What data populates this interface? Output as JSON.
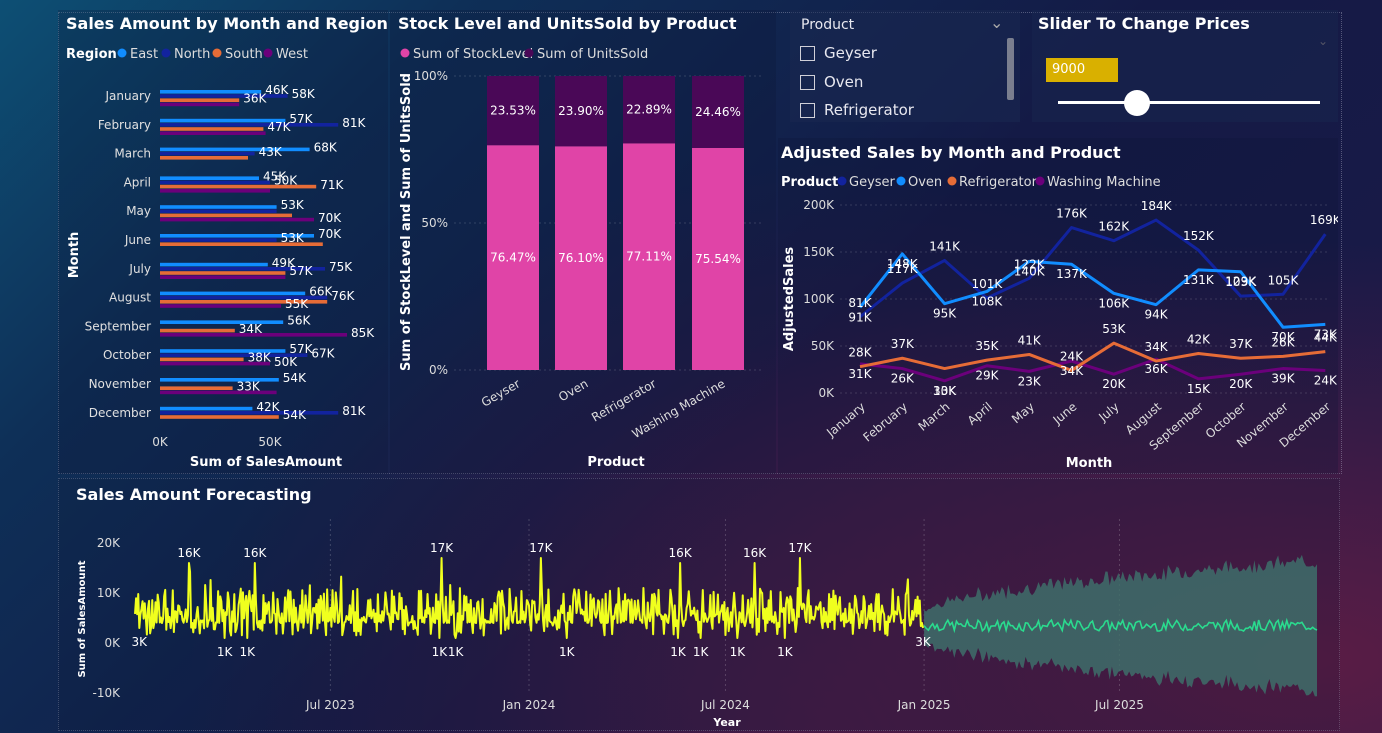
{
  "colors": {
    "east": "#118DFF",
    "north": "#12239E",
    "south": "#E66C37",
    "west": "#6B007B",
    "stock": "#E044A7",
    "units": "#4A0857",
    "geyser": "#12239E",
    "oven": "#118DFF",
    "refrigerator": "#E66C37",
    "washing": "#6B007B",
    "actual": "#F0FF1E",
    "forecast": "#2ADB8E",
    "band": "#3E6E6A",
    "slider_box": "#D9B000"
  },
  "panels": {
    "region": "Sales Amount by Month and Region",
    "stock": "Stock Level and UnitsSold by Product",
    "adjusted": "Adjusted Sales by Month and Product",
    "forecast": "Sales Amount Forecasting"
  },
  "slicer": {
    "title": "Product",
    "items": [
      "Geyser",
      "Oven",
      "Refrigerator"
    ]
  },
  "slider": {
    "title": "Slider To Change Prices",
    "value": "9000",
    "position": 0.3
  },
  "chart_data": [
    {
      "type": "bar",
      "orientation": "horizontal",
      "title": "Sales Amount by Month and Region",
      "xlabel": "Sum of SalesAmount",
      "ylabel": "Month",
      "legend_title": "Region",
      "xlim": [
        0,
        100
      ],
      "x_ticks": [
        "0K",
        "50K"
      ],
      "categories": [
        "January",
        "February",
        "March",
        "April",
        "May",
        "June",
        "July",
        "August",
        "September",
        "October",
        "November",
        "December"
      ],
      "series": [
        {
          "name": "East",
          "values": [
            46,
            57,
            68,
            45,
            53,
            70,
            49,
            66,
            56,
            57,
            54,
            42
          ]
        },
        {
          "name": "North",
          "values": [
            58,
            81,
            43,
            50,
            53,
            53,
            75,
            76,
            null,
            67,
            null,
            81
          ]
        },
        {
          "name": "South",
          "values": [
            36,
            47,
            40,
            71,
            60,
            74,
            57,
            76,
            34,
            38,
            33,
            54
          ]
        },
        {
          "name": "West",
          "values": [
            36,
            48,
            null,
            50,
            70,
            null,
            57,
            55,
            85,
            50,
            53,
            null
          ]
        }
      ],
      "labels": [
        {
          "cat": 0,
          "s": 0,
          "text": "46K"
        },
        {
          "cat": 0,
          "s": 1,
          "text": "58K"
        },
        {
          "cat": 0,
          "s": 2,
          "text": "36K"
        },
        {
          "cat": 1,
          "s": 0,
          "text": "57K"
        },
        {
          "cat": 1,
          "s": 1,
          "text": "81K"
        },
        {
          "cat": 1,
          "s": 2,
          "text": "47K"
        },
        {
          "cat": 2,
          "s": 0,
          "text": "68K"
        },
        {
          "cat": 2,
          "s": 1,
          "text": "43K"
        },
        {
          "cat": 3,
          "s": 0,
          "text": "45K"
        },
        {
          "cat": 3,
          "s": 1,
          "text": "50K"
        },
        {
          "cat": 3,
          "s": 2,
          "text": "71K"
        },
        {
          "cat": 4,
          "s": 0,
          "text": "53K"
        },
        {
          "cat": 4,
          "s": 3,
          "text": "70K"
        },
        {
          "cat": 5,
          "s": 0,
          "text": "70K"
        },
        {
          "cat": 5,
          "s": 1,
          "text": "53K"
        },
        {
          "cat": 6,
          "s": 0,
          "text": "49K"
        },
        {
          "cat": 6,
          "s": 1,
          "text": "75K"
        },
        {
          "cat": 6,
          "s": 2,
          "text": "57K"
        },
        {
          "cat": 7,
          "s": 0,
          "text": "66K"
        },
        {
          "cat": 7,
          "s": 1,
          "text": "76K"
        },
        {
          "cat": 7,
          "s": 3,
          "text": "55K"
        },
        {
          "cat": 8,
          "s": 0,
          "text": "56K"
        },
        {
          "cat": 8,
          "s": 2,
          "text": "34K"
        },
        {
          "cat": 8,
          "s": 3,
          "text": "85K"
        },
        {
          "cat": 9,
          "s": 0,
          "text": "57K"
        },
        {
          "cat": 9,
          "s": 1,
          "text": "67K"
        },
        {
          "cat": 9,
          "s": 2,
          "text": "38K"
        },
        {
          "cat": 9,
          "s": 3,
          "text": "50K"
        },
        {
          "cat": 10,
          "s": 0,
          "text": "54K"
        },
        {
          "cat": 10,
          "s": 2,
          "text": "33K"
        },
        {
          "cat": 11,
          "s": 0,
          "text": "42K"
        },
        {
          "cat": 11,
          "s": 1,
          "text": "81K"
        },
        {
          "cat": 11,
          "s": 2,
          "text": "54K"
        }
      ]
    },
    {
      "type": "bar",
      "stacked": "100%",
      "title": "Stock Level and UnitsSold by Product",
      "xlabel": "Product",
      "ylabel": "Sum of StockLevel and Sum of UnitsSold",
      "y_ticks": [
        "0%",
        "50%",
        "100%"
      ],
      "categories": [
        "Geyser",
        "Oven",
        "Refrigerator",
        "Washing Machine"
      ],
      "series": [
        {
          "name": "Sum of StockLevel",
          "values": [
            76.47,
            76.1,
            77.11,
            75.54
          ],
          "labels": [
            "76.47%",
            "76.10%",
            "77.11%",
            "75.54%"
          ]
        },
        {
          "name": "Sum of UnitsSold",
          "values": [
            23.53,
            23.9,
            22.89,
            24.46
          ],
          "labels": [
            "23.53%",
            "23.90%",
            "22.89%",
            "24.46%"
          ]
        }
      ]
    },
    {
      "type": "line",
      "title": "Adjusted Sales by Month and Product",
      "xlabel": "Month",
      "ylabel": "AdjustedSales",
      "legend_title": "Product",
      "ylim": [
        0,
        200
      ],
      "y_ticks": [
        "0K",
        "50K",
        "100K",
        "150K",
        "200K"
      ],
      "categories": [
        "January",
        "February",
        "March",
        "April",
        "May",
        "June",
        "July",
        "August",
        "September",
        "October",
        "November",
        "December"
      ],
      "series": [
        {
          "name": "Geyser",
          "values": [
            81,
            117,
            141,
            101,
            122,
            176,
            162,
            184,
            152,
            103,
            105,
            169
          ]
        },
        {
          "name": "Oven",
          "values": [
            91,
            148,
            95,
            108,
            140,
            137,
            106,
            94,
            131,
            129,
            70,
            73
          ]
        },
        {
          "name": "Refrigerator",
          "values": [
            28,
            37,
            26,
            35,
            41,
            24,
            53,
            34,
            42,
            37,
            39,
            44
          ]
        },
        {
          "name": "Washing Machine",
          "values": [
            31,
            26,
            13,
            29,
            23,
            34,
            20,
            36,
            15,
            20,
            26,
            24
          ]
        }
      ],
      "labels": [
        {
          "cat": 0,
          "s": 0,
          "text": "81K"
        },
        {
          "cat": 1,
          "s": 0,
          "text": "117K"
        },
        {
          "cat": 2,
          "s": 0,
          "text": "141K"
        },
        {
          "cat": 3,
          "s": 0,
          "text": "101K"
        },
        {
          "cat": 4,
          "s": 0,
          "text": "122K"
        },
        {
          "cat": 5,
          "s": 0,
          "text": "176K"
        },
        {
          "cat": 6,
          "s": 0,
          "text": "162K"
        },
        {
          "cat": 7,
          "s": 0,
          "text": "184K"
        },
        {
          "cat": 8,
          "s": 0,
          "text": "152K"
        },
        {
          "cat": 9,
          "s": 0,
          "text": "103K"
        },
        {
          "cat": 10,
          "s": 0,
          "text": "105K"
        },
        {
          "cat": 11,
          "s": 0,
          "text": "169K"
        },
        {
          "cat": 0,
          "s": 1,
          "text": "91K"
        },
        {
          "cat": 1,
          "s": 1,
          "text": "148K"
        },
        {
          "cat": 2,
          "s": 1,
          "text": "95K"
        },
        {
          "cat": 3,
          "s": 1,
          "text": "108K"
        },
        {
          "cat": 4,
          "s": 1,
          "text": "140K"
        },
        {
          "cat": 5,
          "s": 1,
          "text": "137K"
        },
        {
          "cat": 6,
          "s": 1,
          "text": "106K"
        },
        {
          "cat": 7,
          "s": 1,
          "text": "94K"
        },
        {
          "cat": 8,
          "s": 1,
          "text": "131K"
        },
        {
          "cat": 9,
          "s": 1,
          "text": "129K"
        },
        {
          "cat": 10,
          "s": 1,
          "text": "70K"
        },
        {
          "cat": 11,
          "s": 1,
          "text": "73K"
        },
        {
          "cat": 0,
          "s": 2,
          "text": "28K"
        },
        {
          "cat": 1,
          "s": 2,
          "text": "37K"
        },
        {
          "cat": 3,
          "s": 2,
          "text": "35K"
        },
        {
          "cat": 4,
          "s": 2,
          "text": "41K"
        },
        {
          "cat": 5,
          "s": 2,
          "text": "24K"
        },
        {
          "cat": 6,
          "s": 2,
          "text": "53K"
        },
        {
          "cat": 7,
          "s": 2,
          "text": "34K"
        },
        {
          "cat": 8,
          "s": 2,
          "text": "42K"
        },
        {
          "cat": 9,
          "s": 2,
          "text": "37K"
        },
        {
          "cat": 10,
          "s": 2,
          "text": "26K"
        },
        {
          "cat": 11,
          "s": 2,
          "text": "44K"
        },
        {
          "cat": 0,
          "s": 3,
          "text": "31K"
        },
        {
          "cat": 1,
          "s": 3,
          "text": "26K"
        },
        {
          "cat": 2,
          "s": 3,
          "text": "13K"
        },
        {
          "cat": 2,
          "s": 3,
          "text": "30K"
        },
        {
          "cat": 3,
          "s": 3,
          "text": "29K"
        },
        {
          "cat": 4,
          "s": 3,
          "text": "23K"
        },
        {
          "cat": 5,
          "s": 3,
          "text": "34K"
        },
        {
          "cat": 6,
          "s": 3,
          "text": "20K"
        },
        {
          "cat": 7,
          "s": 3,
          "text": "36K"
        },
        {
          "cat": 8,
          "s": 3,
          "text": "15K"
        },
        {
          "cat": 9,
          "s": 3,
          "text": "20K"
        },
        {
          "cat": 10,
          "s": 3,
          "text": "39K"
        },
        {
          "cat": 11,
          "s": 3,
          "text": "24K"
        }
      ]
    },
    {
      "type": "line",
      "title": "Sales Amount Forecasting",
      "xlabel": "Year",
      "ylabel": "Sum of SalesAmount",
      "ylim": [
        -10,
        20
      ],
      "y_ticks": [
        "-10K",
        "0K",
        "10K",
        "20K"
      ],
      "x_ticks": [
        "Jul 2023",
        "Jan 2024",
        "Jul 2024",
        "Jan 2025",
        "Jul 2025"
      ],
      "x_range": [
        "2023-01-01",
        "2025-12-31"
      ],
      "forecast_start": "2025-01-01",
      "forecast_band": {
        "center": 3.5,
        "half_width_start": 3,
        "half_width_end": 13
      },
      "series": [
        {
          "name": "Actual",
          "values_summary": "daily sales, mostly 1K-10K with spikes up to 17K"
        },
        {
          "name": "Forecast",
          "center": 3.5
        }
      ],
      "annotations": [
        {
          "date": "2023-01-05",
          "value": 3,
          "text": "3K"
        },
        {
          "date": "2023-02-20",
          "value": 16,
          "text": "16K"
        },
        {
          "date": "2023-03-25",
          "value": 1,
          "text": "1K"
        },
        {
          "date": "2023-04-22",
          "value": 16,
          "text": "16K"
        },
        {
          "date": "2023-04-15",
          "value": 1,
          "text": "1K"
        },
        {
          "date": "2023-10-12",
          "value": 17,
          "text": "17K"
        },
        {
          "date": "2023-10-10",
          "value": 1,
          "text": "1K"
        },
        {
          "date": "2023-10-25",
          "value": 1,
          "text": "1K"
        },
        {
          "date": "2024-01-12",
          "value": 17,
          "text": "17K"
        },
        {
          "date": "2024-02-05",
          "value": 1,
          "text": "1K"
        },
        {
          "date": "2024-05-20",
          "value": 16,
          "text": "16K"
        },
        {
          "date": "2024-05-18",
          "value": 1,
          "text": "1K"
        },
        {
          "date": "2024-06-08",
          "value": 1,
          "text": "1K"
        },
        {
          "date": "2024-07-12",
          "value": 1,
          "text": "1K"
        },
        {
          "date": "2024-07-28",
          "value": 16,
          "text": "16K"
        },
        {
          "date": "2024-08-25",
          "value": 1,
          "text": "1K"
        },
        {
          "date": "2024-09-08",
          "value": 17,
          "text": "17K"
        },
        {
          "date": "2024-12-31",
          "value": 3,
          "text": "3K"
        }
      ]
    }
  ]
}
